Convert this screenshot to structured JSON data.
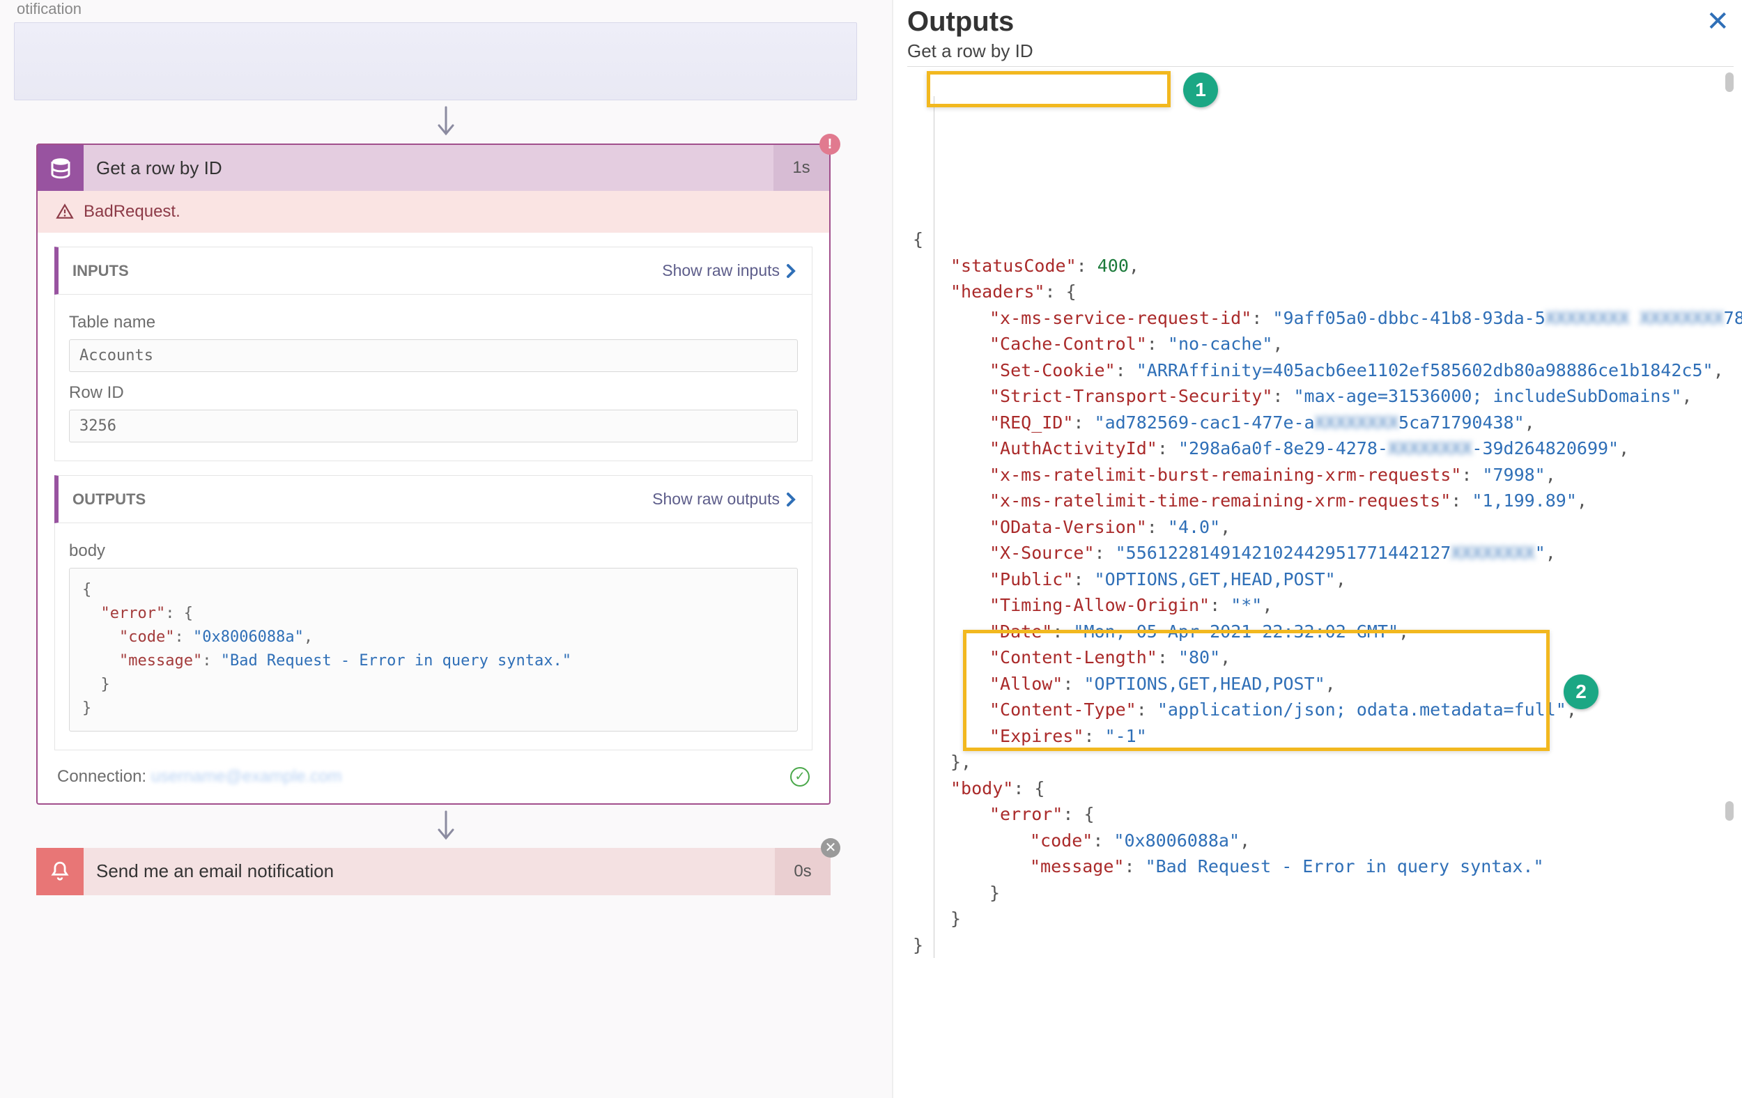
{
  "top_fragment": "otification",
  "flow": {
    "title": "Get a row by ID",
    "duration": "1s",
    "error_label": "BadRequest.",
    "inputs_header": "INPUTS",
    "show_raw_inputs": "Show raw inputs",
    "outputs_header": "OUTPUTS",
    "show_raw_outputs": "Show raw outputs",
    "inputs": {
      "table_name_label": "Table name",
      "table_name_value": "Accounts",
      "row_id_label": "Row ID",
      "row_id_value": "3256"
    },
    "outputs_body_label": "body",
    "outputs_body": {
      "error": {
        "code": "0x8006088a",
        "message": "Bad Request - Error in query syntax."
      }
    },
    "connection_label": "Connection:",
    "connection_value": "username@example.com"
  },
  "notification": {
    "title": "Send me an email notification",
    "duration": "0s"
  },
  "right": {
    "title": "Outputs",
    "subtitle": "Get a row by ID",
    "callout1": "1",
    "callout2": "2",
    "json": {
      "statusCode": 400,
      "headers": {
        "x-ms-service-request-id": "9aff05a0-dbbc-41b8-93da-5________ __78",
        "Cache-Control": "no-cache",
        "Set-Cookie": "ARRAffinity=405acb6ee1102ef585602db80a98886ce1b1842c5",
        "Strict-Transport-Security": "max-age=31536000; includeSubDomains",
        "REQ_ID": "ad782569-cac1-477e-a____5ca71790438",
        "AuthActivityId": "298a6a0f-8e29-4278-____-39d264820699",
        "x-ms-ratelimit-burst-remaining-xrm-requests": "7998",
        "x-ms-ratelimit-time-remaining-xrm-requests": "1,199.89",
        "OData-Version": "4.0",
        "X-Source": "5561228149142102442951771442127____________________",
        "Public": "OPTIONS,GET,HEAD,POST",
        "Timing-Allow-Origin": "*",
        "Date": "Mon, 05 Apr 2021 22:32:02 GMT",
        "Content-Length": "80",
        "Allow": "OPTIONS,GET,HEAD,POST",
        "Content-Type": "application/json; odata.metadata=full",
        "Expires": "-1"
      },
      "body": {
        "error": {
          "code": "0x8006088a",
          "message": "Bad Request - Error in query syntax."
        }
      }
    }
  }
}
